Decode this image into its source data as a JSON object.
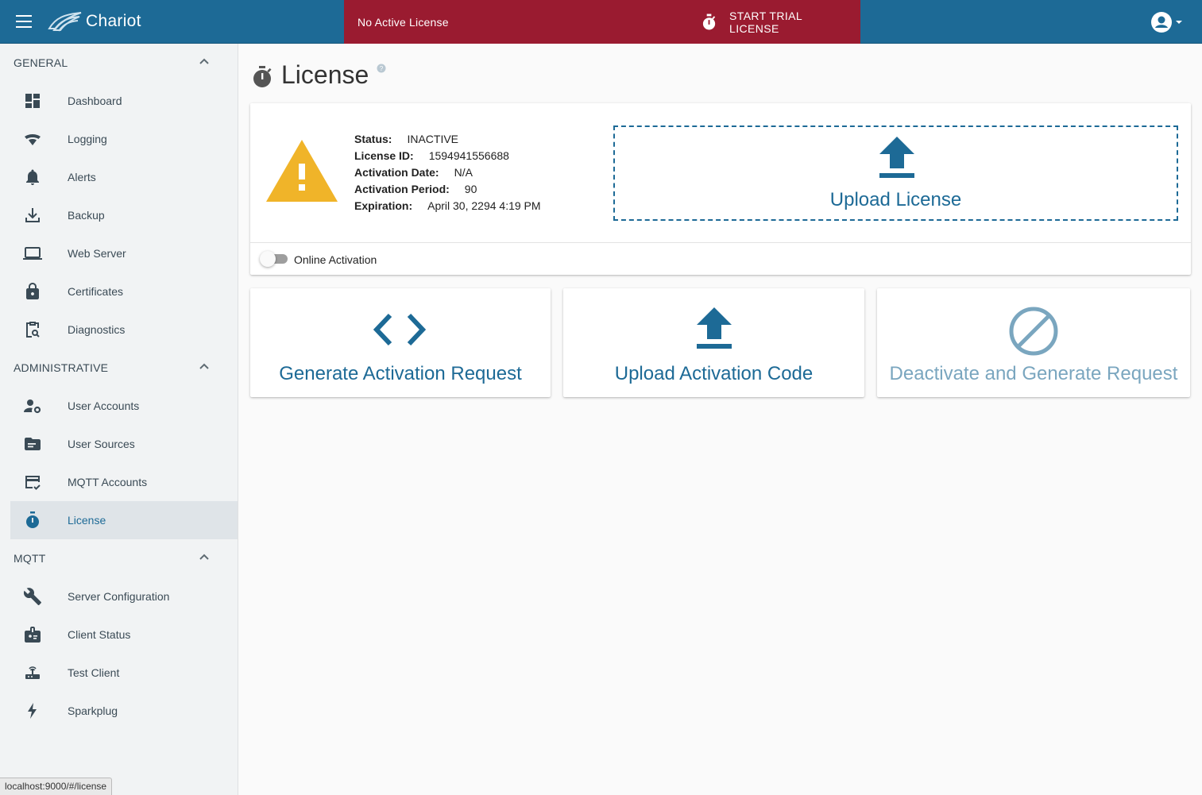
{
  "app": {
    "brand": "Chariot"
  },
  "banner": {
    "message": "No Active License",
    "trial_button": "START TRIAL LICENSE",
    "color": "#9a1b30"
  },
  "theme": {
    "primary": "#1d6a96",
    "warning": "#f0b429"
  },
  "sidebar": {
    "sections": [
      {
        "title": "GENERAL",
        "items": [
          {
            "label": "Dashboard",
            "icon": "dashboard-icon"
          },
          {
            "label": "Logging",
            "icon": "wifi-icon"
          },
          {
            "label": "Alerts",
            "icon": "bell-icon"
          },
          {
            "label": "Backup",
            "icon": "download-icon"
          },
          {
            "label": "Web Server",
            "icon": "laptop-icon"
          },
          {
            "label": "Certificates",
            "icon": "lock-icon"
          },
          {
            "label": "Diagnostics",
            "icon": "clipboard-search-icon"
          }
        ]
      },
      {
        "title": "ADMINISTRATIVE",
        "items": [
          {
            "label": "User Accounts",
            "icon": "user-cog-icon"
          },
          {
            "label": "User Sources",
            "icon": "folder-list-icon"
          },
          {
            "label": "MQTT Accounts",
            "icon": "card-check-icon"
          },
          {
            "label": "License",
            "icon": "timer-icon",
            "active": true
          }
        ]
      },
      {
        "title": "MQTT",
        "items": [
          {
            "label": "Server Configuration",
            "icon": "wrench-icon"
          },
          {
            "label": "Client Status",
            "icon": "badge-icon"
          },
          {
            "label": "Test Client",
            "icon": "router-icon"
          },
          {
            "label": "Sparkplug",
            "icon": "lightning-icon"
          }
        ]
      }
    ]
  },
  "page": {
    "title": "License"
  },
  "license": {
    "fields": [
      {
        "key": "Status:",
        "value": "INACTIVE"
      },
      {
        "key": "License ID:",
        "value": "1594941556688"
      },
      {
        "key": "Activation Date:",
        "value": "N/A"
      },
      {
        "key": "Activation Period:",
        "value": "90"
      },
      {
        "key": "Expiration:",
        "value": "April 30, 2294 4:19 PM"
      }
    ],
    "upload_label": "Upload License",
    "online_activation_label": "Online Activation",
    "online_activation_enabled": false
  },
  "actions": [
    {
      "label": "Generate Activation Request",
      "icon": "code-brackets-icon",
      "enabled": true
    },
    {
      "label": "Upload Activation Code",
      "icon": "upload-icon",
      "enabled": true
    },
    {
      "label": "Deactivate and Generate Request",
      "icon": "block-icon",
      "enabled": false
    }
  ],
  "statusbar": {
    "url": "localhost:9000/#/license"
  }
}
